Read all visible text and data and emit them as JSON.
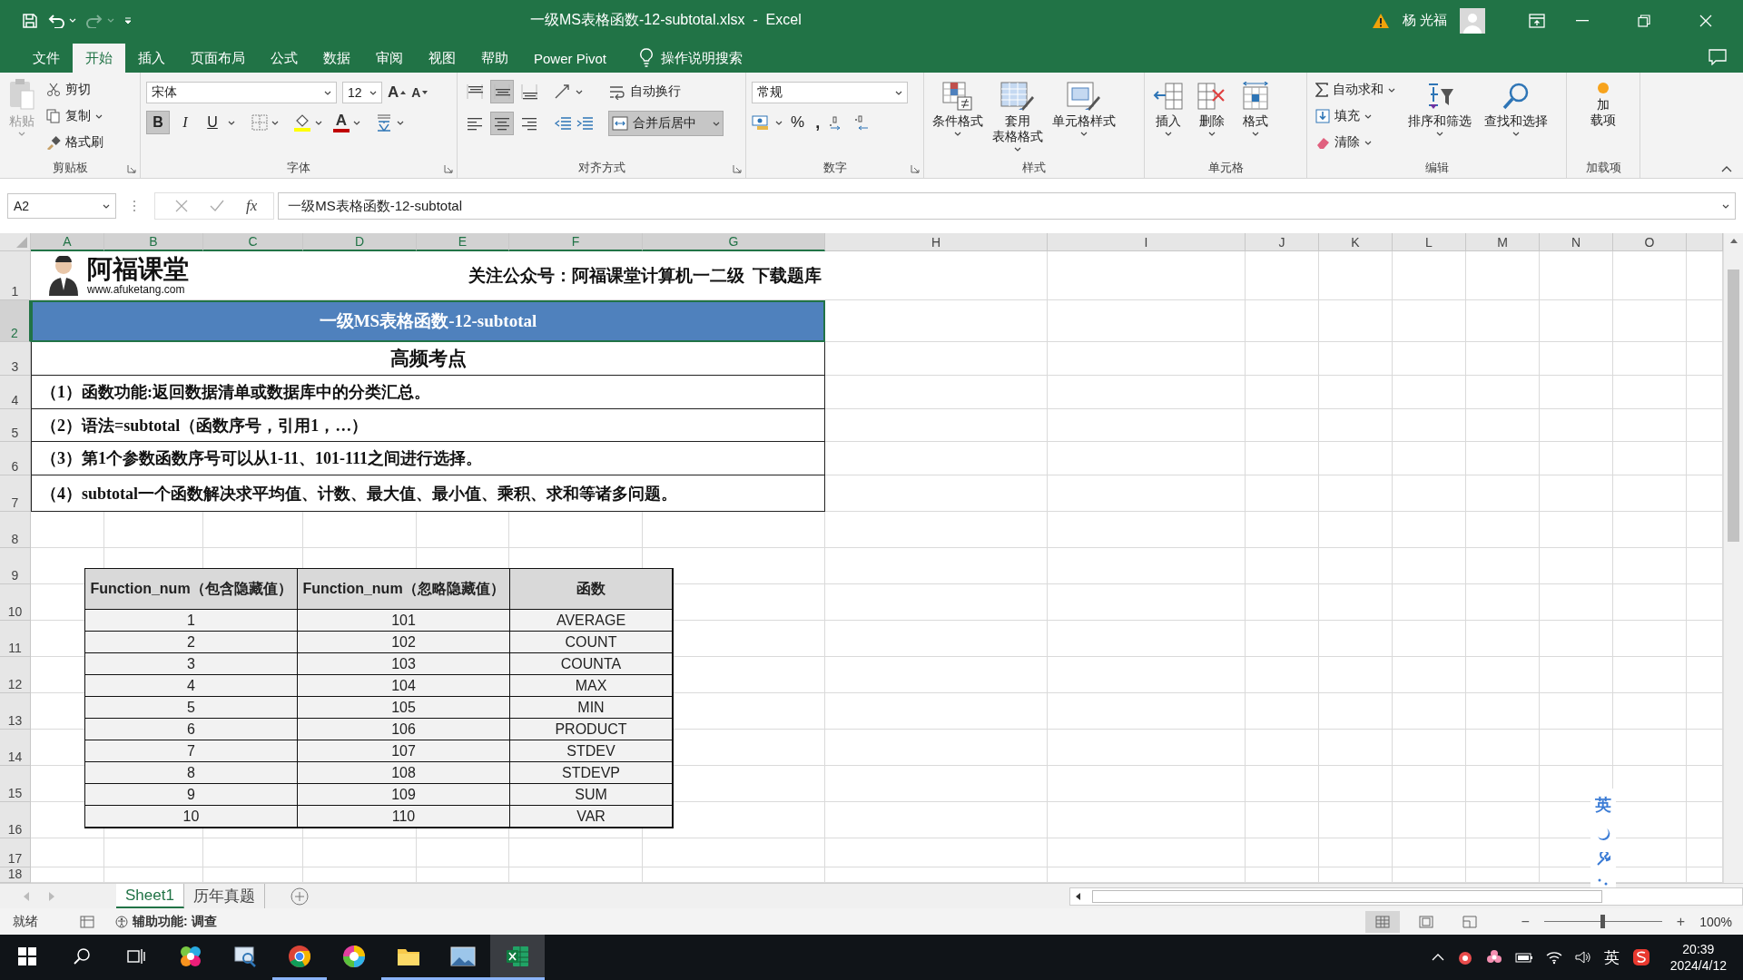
{
  "title_bar": {
    "quick_access": [
      {
        "kind": "save",
        "disabled": false
      },
      {
        "kind": "undo",
        "disabled": false
      },
      {
        "kind": "redo",
        "disabled": true
      }
    ],
    "title": "一级MS表格函数-12-subtotal.xlsx  -  Excel",
    "user": "杨 光福"
  },
  "menu_tabs": [
    {
      "label": "文件",
      "selected": false
    },
    {
      "label": "开始",
      "selected": true
    },
    {
      "label": "插入",
      "selected": false
    },
    {
      "label": "页面布局",
      "selected": false
    },
    {
      "label": "公式",
      "selected": false
    },
    {
      "label": "数据",
      "selected": false
    },
    {
      "label": "审阅",
      "selected": false
    },
    {
      "label": "视图",
      "selected": false
    },
    {
      "label": "帮助",
      "selected": false
    },
    {
      "label": "Power Pivot",
      "selected": false
    }
  ],
  "tell_me": "操作说明搜索",
  "ribbon": {
    "clipboard": {
      "label": "剪贴板",
      "paste": {
        "label": "粘贴",
        "disabled": true
      },
      "items": [
        {
          "kind": "cut",
          "label": "剪切"
        },
        {
          "kind": "copy",
          "label": "复制"
        },
        {
          "kind": "format_painter",
          "label": "格式刷"
        }
      ]
    },
    "font": {
      "label": "字体",
      "font_name": "宋体",
      "font_size": "12",
      "grow": "A",
      "shrink": "A",
      "font_color": "A",
      "styles": [
        {
          "kind": "bold",
          "label": "B",
          "selected": true
        },
        {
          "kind": "italic",
          "label": "I",
          "selected": false
        },
        {
          "kind": "underline",
          "label": "U",
          "selected": false
        }
      ]
    },
    "alignment": {
      "label": "对齐方式",
      "vertical": [
        {
          "kind": "top",
          "selected": false
        },
        {
          "kind": "middle",
          "selected": true
        },
        {
          "kind": "bottom",
          "selected": false
        }
      ],
      "horizontal": [
        {
          "kind": "left",
          "selected": false
        },
        {
          "kind": "center",
          "selected": true
        },
        {
          "kind": "right",
          "selected": false
        }
      ],
      "wrap_text": "自动换行",
      "merge": {
        "label": "合并后居中",
        "selected": true
      }
    },
    "number": {
      "label": "数字",
      "format": "常规",
      "percent": "%",
      "comma": ","
    },
    "styles": {
      "label": "样式",
      "buttons": [
        {
          "kind": "conditional",
          "lines": [
            "条件格式"
          ]
        },
        {
          "kind": "table",
          "lines": [
            "套用",
            "表格格式"
          ]
        },
        {
          "kind": "cell",
          "lines": [
            "单元格样式"
          ]
        }
      ]
    },
    "cells": {
      "label": "单元格",
      "buttons": [
        {
          "kind": "insert",
          "label": "插入"
        },
        {
          "kind": "delete",
          "label": "删除"
        },
        {
          "kind": "format",
          "label": "格式"
        }
      ]
    },
    "editing": {
      "label": "编辑",
      "items": [
        {
          "kind": "autosum",
          "label": "自动求和"
        },
        {
          "kind": "fill",
          "label": "填充"
        },
        {
          "kind": "clear",
          "label": "清除"
        }
      ],
      "buttons": [
        {
          "kind": "sort",
          "label": "排序和筛选"
        },
        {
          "kind": "find",
          "label": "查找和选择"
        }
      ]
    },
    "addins": {
      "label": "加载项",
      "lines": [
        "加",
        "载项"
      ]
    }
  },
  "formula_bar": {
    "name_box": "A2",
    "function_button": "fx",
    "content": "一级MS表格函数-12-subtotal"
  },
  "sheet": {
    "columns": [
      {
        "label": "A",
        "selected": true
      },
      {
        "label": "B",
        "selected": true
      },
      {
        "label": "C",
        "selected": true
      },
      {
        "label": "D",
        "selected": true
      },
      {
        "label": "E",
        "selected": true
      },
      {
        "label": "F",
        "selected": true
      },
      {
        "label": "G",
        "selected": true
      },
      {
        "label": "H",
        "selected": false
      },
      {
        "label": "I",
        "selected": false
      },
      {
        "label": "J",
        "selected": false
      },
      {
        "label": "K",
        "selected": false
      },
      {
        "label": "L",
        "selected": false
      },
      {
        "label": "M",
        "selected": false
      },
      {
        "label": "N",
        "selected": false
      },
      {
        "label": "O",
        "selected": false
      }
    ],
    "rows": [
      {
        "label": "1",
        "selected": false
      },
      {
        "label": "2",
        "selected": true
      },
      {
        "label": "3",
        "selected": false
      },
      {
        "label": "4",
        "selected": false
      },
      {
        "label": "5",
        "selected": false
      },
      {
        "label": "6",
        "selected": false
      },
      {
        "label": "7",
        "selected": false
      },
      {
        "label": "8",
        "selected": false
      },
      {
        "label": "9",
        "selected": false
      },
      {
        "label": "10",
        "selected": false
      },
      {
        "label": "11",
        "selected": false
      },
      {
        "label": "12",
        "selected": false
      },
      {
        "label": "13",
        "selected": false
      },
      {
        "label": "14",
        "selected": false
      },
      {
        "label": "15",
        "selected": false
      },
      {
        "label": "16",
        "selected": false
      },
      {
        "label": "17",
        "selected": false
      },
      {
        "label": "18",
        "selected": false
      }
    ],
    "content": [
      {
        "kind": "logo",
        "logo_text": "阿福课堂",
        "url": "www.afuketang.com",
        "notice": "关注公众号：阿福课堂计算机一二级  下载题库"
      },
      {
        "kind": "banner",
        "text": "一级MS表格函数-12-subtotal",
        "selected": true
      },
      {
        "kind": "heading",
        "text": "高频考点"
      },
      {
        "kind": "point",
        "text": "（1）函数功能:返回数据清单或数据库中的分类汇总。"
      },
      {
        "kind": "point",
        "text": "（2）语法=subtotal（函数序号，引用1，…）"
      },
      {
        "kind": "point",
        "text": "（3）第1个参数函数序号可以从1-11、101-111之间进行选择。"
      },
      {
        "kind": "point",
        "text": "（4）subtotal一个函数解决求平均值、计数、最大值、最小值、乘积、求和等诸多问题。"
      }
    ],
    "table": {
      "columns": [
        "Function_num（包含隐藏值）",
        "Function_num（忽略隐藏值）",
        "函数"
      ],
      "rows": [
        [
          "1",
          "101",
          "AVERAGE"
        ],
        [
          "2",
          "102",
          "COUNT"
        ],
        [
          "3",
          "103",
          "COUNTA"
        ],
        [
          "4",
          "104",
          "MAX"
        ],
        [
          "5",
          "105",
          "MIN"
        ],
        [
          "6",
          "106",
          "PRODUCT"
        ],
        [
          "7",
          "107",
          "STDEV"
        ],
        [
          "8",
          "108",
          "STDEVP"
        ],
        [
          "9",
          "109",
          "SUM"
        ],
        [
          "10",
          "110",
          "VAR"
        ]
      ]
    }
  },
  "ime_bar": {
    "label": "英"
  },
  "sheet_tabs": [
    {
      "label": "Sheet1",
      "selected": true
    },
    {
      "label": "历年真题",
      "selected": false
    }
  ],
  "status_bar": {
    "ready": "就绪",
    "accessibility": "辅助功能: 调查",
    "views": [
      {
        "kind": "normal",
        "selected": true
      },
      {
        "kind": "page_layout",
        "selected": false
      },
      {
        "kind": "page_break",
        "selected": false
      }
    ],
    "zoom_minus": "−",
    "zoom_plus": "+",
    "zoom_level": {
      "level": 0.49
    },
    "zoom_percent": "100%"
  },
  "taskbar": {
    "apps": [
      {
        "kind": "pinwheel",
        "running": false,
        "selected": false
      },
      {
        "kind": "magnifier_screen",
        "running": false,
        "selected": false
      },
      {
        "kind": "chrome",
        "running": true,
        "selected": false
      },
      {
        "kind": "color_wheel",
        "running": false,
        "selected": false
      },
      {
        "kind": "folder",
        "running": true,
        "selected": false
      },
      {
        "kind": "photo",
        "running": true,
        "selected": false
      },
      {
        "kind": "excel",
        "running": true,
        "selected": true
      }
    ],
    "language": "英",
    "time": "20:39",
    "date": "2024/4/12"
  }
}
